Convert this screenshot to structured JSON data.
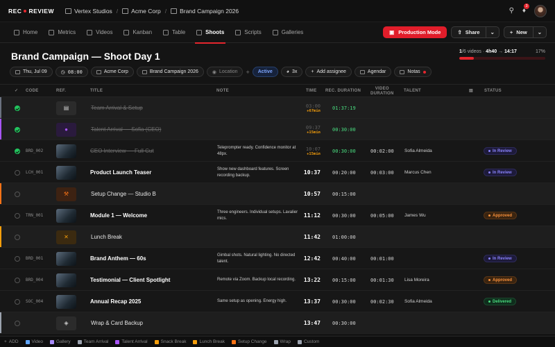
{
  "app": {
    "logo_left": "REC",
    "logo_right": "REVIEW"
  },
  "breadcrumbs": [
    "Vertex Studios",
    "Acme Corp",
    "Brand Campaign 2026"
  ],
  "notifications_count": "3",
  "nav": {
    "tabs": [
      {
        "label": "Home",
        "active": false
      },
      {
        "label": "Metrics",
        "active": false
      },
      {
        "label": "Videos",
        "active": false
      },
      {
        "label": "Kanban",
        "active": false
      },
      {
        "label": "Table",
        "active": false
      },
      {
        "label": "Shoots",
        "active": true
      },
      {
        "label": "Scripts",
        "active": false
      },
      {
        "label": "Galleries",
        "active": false
      }
    ],
    "production_mode": "Production Mode",
    "share": "Share",
    "new": "New"
  },
  "header": {
    "title": "Brand Campaign — Shoot Day 1",
    "progress_done": "1",
    "progress_total": "/6 videos",
    "duration_done": "4h40",
    "duration_end": "14:17",
    "percent_label": "17%",
    "percent": 17
  },
  "chips": {
    "date": "Thu, Jul 09",
    "start": "08:00",
    "client": "Acme Corp",
    "project": "Brand Campaign 2026",
    "location": "Location",
    "status": "Active",
    "multiplier": "3x",
    "add_assignee": "Add assignee",
    "agendar": "Agendar",
    "notas": "Notas"
  },
  "columns": {
    "code": "CODE",
    "ref": "REF.",
    "title": "TITLE",
    "note": "NOTE",
    "time": "TIME",
    "rec": "REC. DURATION",
    "vdur_1": "VIDEO",
    "vdur_2": "DURATION",
    "talent": "TALENT",
    "status": "STATUS"
  },
  "colors": {
    "accent": "#e5262e",
    "block_orange": "#f97316",
    "block_purple": "#a855f7",
    "block_amber": "#f59e0b"
  },
  "rows": [
    {
      "kind": "block",
      "done": true,
      "code": "",
      "thumb": "clapper-icon",
      "thumb_color": "#c9c9c9",
      "bar": "#6b7280",
      "title": "Team Arrival & Setup",
      "struck": true,
      "note": "",
      "time": "03:00",
      "delta": "+67min",
      "rec": "01:37:19",
      "rec_green": true,
      "vdur": "",
      "talent": "",
      "status": "",
      "status_kind": ""
    },
    {
      "kind": "block",
      "done": true,
      "code": "",
      "thumb": "mic-icon",
      "thumb_color": "#a855f7",
      "thumb_bg": "#2a1a3d",
      "bar": "#a855f7",
      "title": "Talent Arrival — Sofia (CEO)",
      "struck": true,
      "note": "",
      "time": "09:37",
      "delta": "+15min",
      "rec": "00:30:00",
      "rec_green": true,
      "vdur": "",
      "talent": "",
      "status": "",
      "status_kind": ""
    },
    {
      "kind": "video",
      "done": true,
      "code": "BRD_002",
      "thumb": "photo",
      "bar": "",
      "title": "CEO Interview — Full Cut",
      "struck": true,
      "note": "Teleprompter ready. Confidence monitor at 48px.",
      "time": "10:07",
      "delta": "+15min",
      "rec": "00:30:00",
      "rec_green": true,
      "vdur": "00:02:00",
      "talent": "Sofia Almeida",
      "status": "In Review",
      "status_kind": "rev"
    },
    {
      "kind": "video",
      "done": false,
      "code": "LCH_001",
      "thumb": "photo",
      "bar": "",
      "title": "Product Launch Teaser",
      "struck": false,
      "note": "Show new dashboard features. Screen recording backup.",
      "time": "10:37",
      "delta": "",
      "rec": "00:20:00",
      "rec_green": false,
      "vdur": "00:03:00",
      "talent": "Marcus Chen",
      "status": "In Review",
      "status_kind": "rev"
    },
    {
      "kind": "block",
      "done": false,
      "code": "",
      "thumb": "wrench-icon",
      "thumb_color": "#f97316",
      "thumb_bg": "#3d2212",
      "bar": "#f97316",
      "title": "Setup Change — Studio B",
      "struck": false,
      "note": "",
      "time": "10:57",
      "delta": "",
      "rec": "00:15:00",
      "rec_green": false,
      "vdur": "",
      "talent": "",
      "status": "",
      "status_kind": ""
    },
    {
      "kind": "video",
      "done": false,
      "code": "TRN_001",
      "thumb": "photo",
      "bar": "",
      "title": "Module 1 — Welcome",
      "struck": false,
      "note": "Three engineers. Individual setups. Lavalier mics.",
      "time": "11:12",
      "delta": "",
      "rec": "00:30:00",
      "rec_green": false,
      "vdur": "00:05:00",
      "talent": "James Wu",
      "status": "Approved",
      "status_kind": "app"
    },
    {
      "kind": "block",
      "done": false,
      "code": "",
      "thumb": "utensils-icon",
      "thumb_color": "#f59e0b",
      "thumb_bg": "#3b2a10",
      "bar": "#f59e0b",
      "title": "Lunch Break",
      "struck": false,
      "note": "",
      "time": "11:42",
      "delta": "",
      "rec": "01:00:00",
      "rec_green": false,
      "vdur": "",
      "talent": "",
      "status": "",
      "status_kind": ""
    },
    {
      "kind": "video",
      "done": false,
      "code": "BRD_001",
      "thumb": "photo",
      "bar": "",
      "title": "Brand Anthem — 60s",
      "struck": false,
      "note": "Gimbal shots. Natural lighting. No directed talent.",
      "time": "12:42",
      "delta": "",
      "rec": "00:40:00",
      "rec_green": false,
      "vdur": "00:01:00",
      "talent": "",
      "status": "In Review",
      "status_kind": "rev"
    },
    {
      "kind": "video",
      "done": false,
      "code": "BRD_004",
      "thumb": "photo",
      "bar": "",
      "title": "Testimonial — Client Spotlight",
      "struck": false,
      "note": "Remote via Zoom. Backup local recording.",
      "time": "13:22",
      "delta": "",
      "rec": "00:15:00",
      "rec_green": false,
      "vdur": "00:01:30",
      "talent": "Lisa Moreira",
      "status": "Approved",
      "status_kind": "app"
    },
    {
      "kind": "video",
      "done": false,
      "code": "SOC_004",
      "thumb": "photo",
      "bar": "",
      "title": "Annual Recap 2025",
      "struck": false,
      "note": "Same setup as opening. Energy high.",
      "time": "13:37",
      "delta": "",
      "rec": "00:30:00",
      "rec_green": false,
      "vdur": "00:02:30",
      "talent": "Sofia Almeida",
      "status": "Delivered",
      "status_kind": "del"
    },
    {
      "kind": "block",
      "done": false,
      "code": "",
      "thumb": "box-icon",
      "thumb_color": "#c9c9c9",
      "bar": "#9ca3af",
      "title": "Wrap & Card Backup",
      "struck": false,
      "note": "",
      "time": "13:47",
      "delta": "",
      "rec": "00:30:00",
      "rec_green": false,
      "vdur": "",
      "talent": "",
      "status": "",
      "status_kind": ""
    }
  ],
  "bottom": {
    "add": "ADD",
    "items": [
      {
        "label": "Video",
        "color": "#60a5fa"
      },
      {
        "label": "Gallery",
        "color": "#a78bfa"
      },
      {
        "label": "Team Arrival",
        "color": "#9ca3af"
      },
      {
        "label": "Talent Arrival",
        "color": "#a855f7"
      },
      {
        "label": "Snack Break",
        "color": "#f59e0b"
      },
      {
        "label": "Lunch Break",
        "color": "#f59e0b"
      },
      {
        "label": "Setup Change",
        "color": "#f97316"
      },
      {
        "label": "Wrap",
        "color": "#9ca3af"
      },
      {
        "label": "Custom",
        "color": "#9ca3af"
      }
    ]
  }
}
